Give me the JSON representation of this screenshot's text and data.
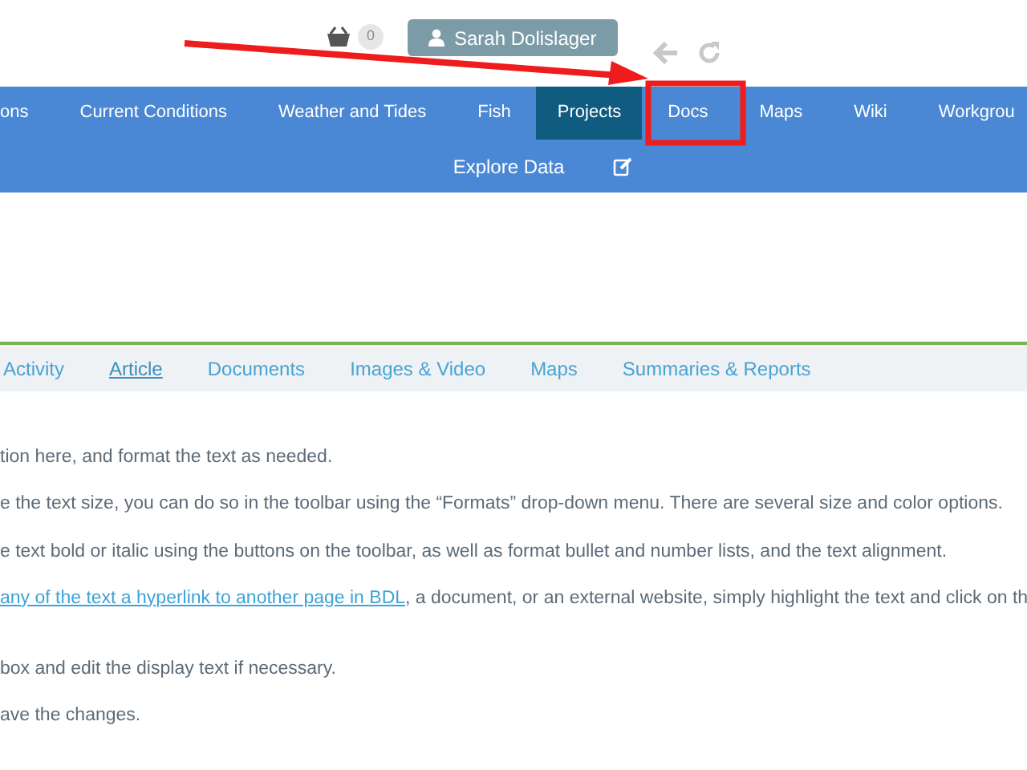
{
  "header": {
    "cart_count": "0",
    "user": "Sarah Dolislager"
  },
  "nav": {
    "items": [
      {
        "label": "ons",
        "selected": false
      },
      {
        "label": "Current Conditions",
        "selected": false
      },
      {
        "label": "Weather and Tides",
        "selected": false
      },
      {
        "label": "Fish",
        "selected": false
      },
      {
        "label": "Projects",
        "selected": true
      },
      {
        "label": "Docs",
        "selected": false
      },
      {
        "label": "Maps",
        "selected": false
      },
      {
        "label": "Wiki",
        "selected": false
      },
      {
        "label": "Workgrou",
        "selected": false
      }
    ],
    "row_2": [
      {
        "label": "Explore Data"
      }
    ]
  },
  "subnav": {
    "tabs": [
      {
        "label": "Activity",
        "selected": false
      },
      {
        "label": "Article",
        "selected": true
      },
      {
        "label": "Documents",
        "selected": false
      },
      {
        "label": "Images & Video",
        "selected": false
      },
      {
        "label": "Maps",
        "selected": false
      },
      {
        "label": "Summaries & Reports",
        "selected": false
      }
    ]
  },
  "content": {
    "lines": [
      {
        "text": "tion here, and format the text as needed."
      },
      {
        "text": "e the text size, you can do so in the toolbar using the “Formats” drop-down menu. There are several size and color options."
      },
      {
        "text": "e text bold or italic using the buttons on the toolbar, as well as format bullet and number lists, and the text alignment."
      },
      {
        "link": "any of the text a hyperlink to another page in BDL",
        "text": ", a document, or an external website, simply highlight the text and click on th"
      },
      {
        "text": "box and edit the display text if necessary."
      },
      {
        "text": "ave the changes."
      }
    ]
  }
}
